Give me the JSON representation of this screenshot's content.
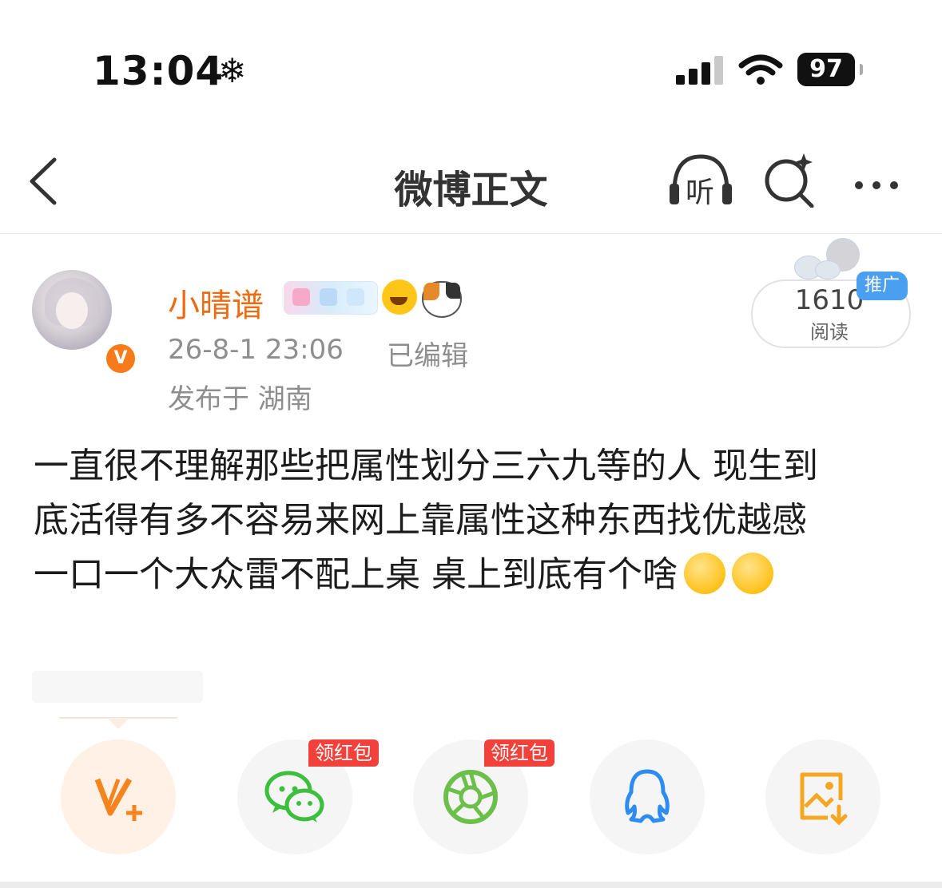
{
  "status_bar": {
    "time": "13:04",
    "weather_icon": "❄",
    "battery": "97"
  },
  "nav": {
    "title": "微博正文",
    "listen_label": "听"
  },
  "post": {
    "author": "小晴谱",
    "verified_badge": "V",
    "time": "26-8-1 23:06",
    "edited": "已编辑",
    "location": "发布于 湖南",
    "reads": "1610",
    "reads_label": "阅读",
    "promo": "推广",
    "text_lines": [
      "一直很不理解那些把属性划分三六九等的人 现生到",
      "底活得有多不容易来网上靠属性这种东西找优越感",
      "一口一个大众雷不配上桌 桌上到底有个啥"
    ]
  },
  "share": {
    "redpack_label": "领红包",
    "items": [
      "vplus-icon",
      "wechat-icon",
      "moments-icon",
      "qq-icon",
      "save-image-icon"
    ]
  },
  "colors": {
    "accent": "#f06a0f",
    "promo": "#4a9ff0",
    "redpack": "#f2413a"
  }
}
